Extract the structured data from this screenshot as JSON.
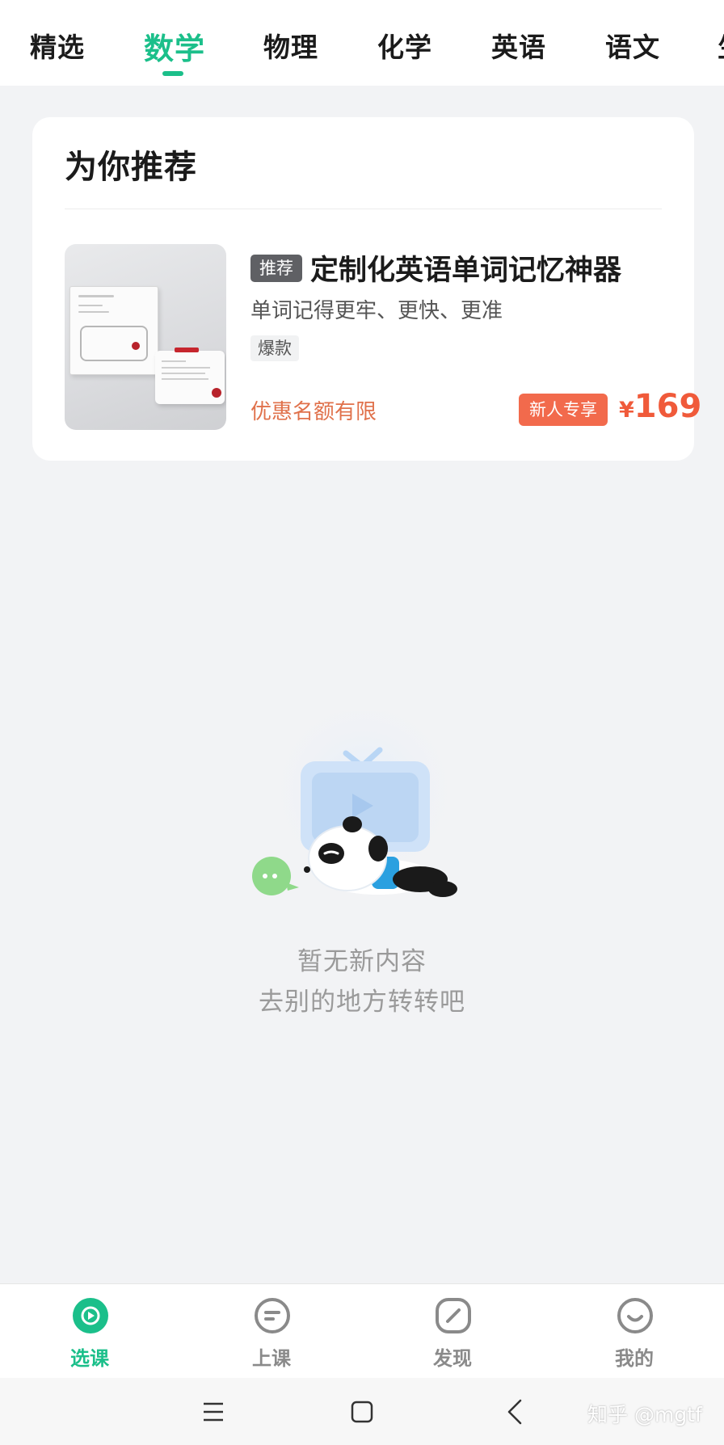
{
  "top_tabs": [
    {
      "label": "精选"
    },
    {
      "label": "数学"
    },
    {
      "label": "物理"
    },
    {
      "label": "化学"
    },
    {
      "label": "英语"
    },
    {
      "label": "语文"
    },
    {
      "label": "生"
    }
  ],
  "active_tab": "数学",
  "recommend": {
    "title": "为你推荐",
    "product": {
      "badge": "推荐",
      "title": "定制化英语单词记忆神器",
      "subtitle": "单词记得更牢、更快、更准",
      "tag": "爆款",
      "limit_text": "优惠名额有限",
      "new_user_badge": "新人专享",
      "currency": "¥",
      "price": "169"
    }
  },
  "empty_state": {
    "line1": "暂无新内容",
    "line2": "去别的地方转转吧"
  },
  "bottom_nav": [
    {
      "label": "选课",
      "icon": "play-circle-icon"
    },
    {
      "label": "上课",
      "icon": "class-icon"
    },
    {
      "label": "发现",
      "icon": "discover-icon"
    },
    {
      "label": "我的",
      "icon": "smile-icon"
    }
  ],
  "watermark": "知乎 @mgtf",
  "colors": {
    "accent": "#1bbf8a",
    "price": "#f05a3a",
    "limit_text": "#e0714b",
    "new_badge_bg": "#f26a4c",
    "background": "#f2f3f5"
  }
}
